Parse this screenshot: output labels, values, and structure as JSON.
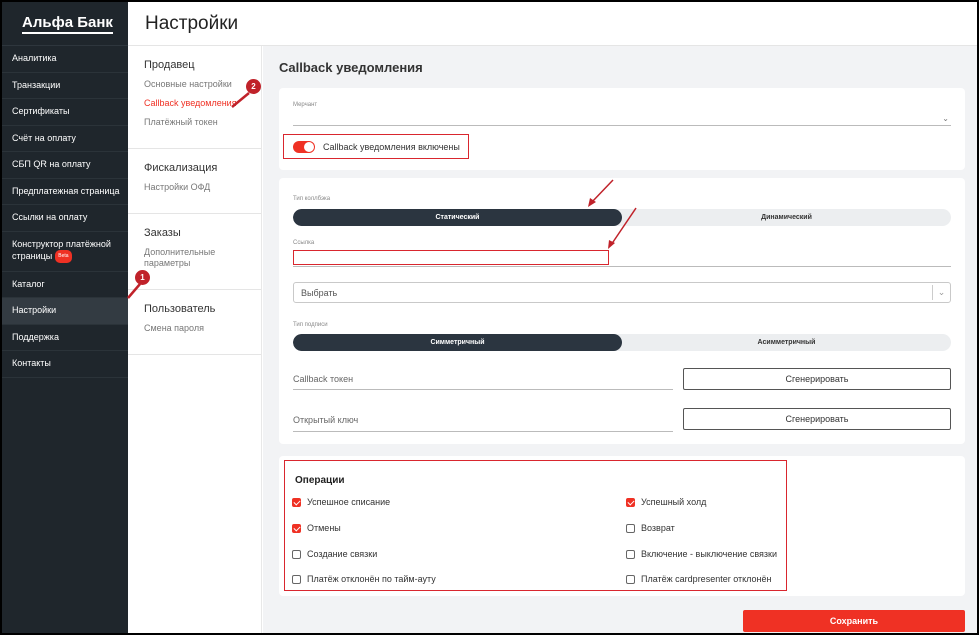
{
  "brand": "Альфа Банк",
  "header_title": "Настройки",
  "nav": [
    {
      "label": "Аналитика"
    },
    {
      "label": "Транзакции"
    },
    {
      "label": "Сертификаты"
    },
    {
      "label": "Счёт на оплату"
    },
    {
      "label": "СБП QR на оплату"
    },
    {
      "label": "Предплатежная страница"
    },
    {
      "label": "Ссылки на оплату"
    },
    {
      "label": "Конструктор платёжной страницы",
      "badge": "Beta"
    },
    {
      "label": "Каталог"
    },
    {
      "label": "Настройки"
    },
    {
      "label": "Поддержка"
    },
    {
      "label": "Контакты"
    }
  ],
  "subnav": {
    "seller": {
      "title": "Продавец",
      "links": [
        "Основные настройки",
        "Callback уведомления",
        "Платёжный токен"
      ]
    },
    "fiscal": {
      "title": "Фискализация",
      "links": [
        "Настройки ОФД"
      ]
    },
    "orders": {
      "title": "Заказы",
      "links": [
        "Дополнительные параметры"
      ]
    },
    "user": {
      "title": "Пользователь",
      "links": [
        "Смена пароля"
      ]
    }
  },
  "main": {
    "title": "Callback уведомления",
    "merchant_label": "Мерчант",
    "toggle_label": "Callback уведомления включены",
    "callback_type_label": "Тип коллбэка",
    "callback_type_options": [
      "Статический",
      "Динамический"
    ],
    "link_label": "Ссылка",
    "select_placeholder": "Выбрать",
    "sign_type_label": "Тип подписи",
    "sign_type_options": [
      "Симметричный",
      "Асимметричный"
    ],
    "callback_token_label": "Callback токен",
    "public_key_label": "Открытый ключ",
    "generate_label": "Сгенерировать",
    "save_label": "Сохранить"
  },
  "operations": {
    "title": "Операции",
    "items": [
      {
        "label": "Успешное списание",
        "checked": true
      },
      {
        "label": "Отмены",
        "checked": true
      },
      {
        "label": "Создание связки",
        "checked": false
      },
      {
        "label": "Платёж отклонён по тайм-ауту",
        "checked": false
      },
      {
        "label": "Успешный холд",
        "checked": true
      },
      {
        "label": "Возврат",
        "checked": false
      },
      {
        "label": "Включение - выключение связки",
        "checked": false
      },
      {
        "label": "Платёж cardpresenter отклонён",
        "checked": false
      }
    ]
  },
  "markers": [
    "1",
    "2"
  ],
  "colors": {
    "accent": "#ef3124",
    "sidebar": "#1f262c",
    "dark_segment": "#2b3540"
  }
}
